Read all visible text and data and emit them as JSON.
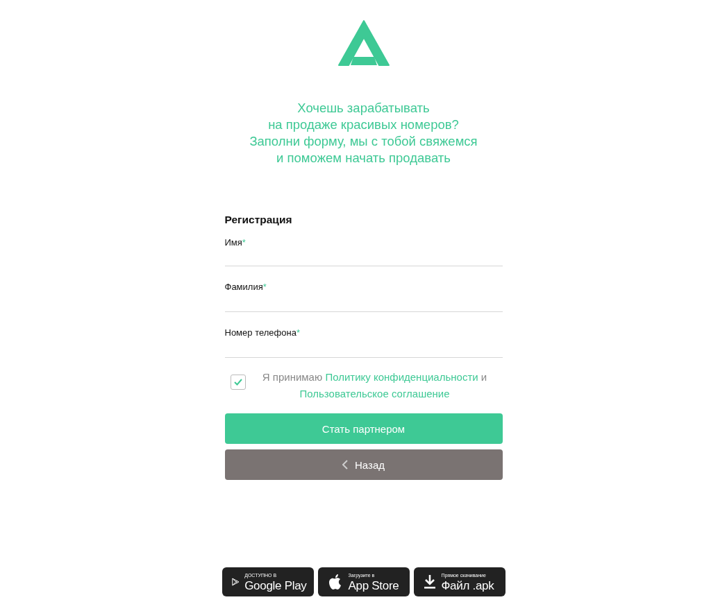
{
  "tagline": [
    "Хочешь зарабатывать",
    "на продаже красивых номеров?",
    "Заполни форму, мы с тобой свяжемся",
    "и поможем начать продавать"
  ],
  "form": {
    "title": "Регистрация",
    "fields": [
      {
        "label": "Имя",
        "mark": "*"
      },
      {
        "label": "Фамилия",
        "mark": "*"
      },
      {
        "label": "Номер телефона",
        "mark": "*"
      }
    ],
    "consent": {
      "checked": true,
      "before": "Я принимаю",
      "link_1": "Политику конфиденциальности",
      "between": "и",
      "link_2": "Пользовательское соглашение"
    },
    "buttons": [
      {
        "kind": "primary",
        "label": "Стать партнером"
      },
      {
        "kind": "back",
        "label": "Назад"
      }
    ]
  },
  "stores": [
    {
      "kind": "play",
      "small": "ДОСТУПНО В",
      "big": "Google Play"
    },
    {
      "kind": "apple",
      "small": "Загрузите в",
      "big": "App Store"
    },
    {
      "kind": "download",
      "small": "Прямое скачивание",
      "big": "Файл .apk"
    }
  ]
}
